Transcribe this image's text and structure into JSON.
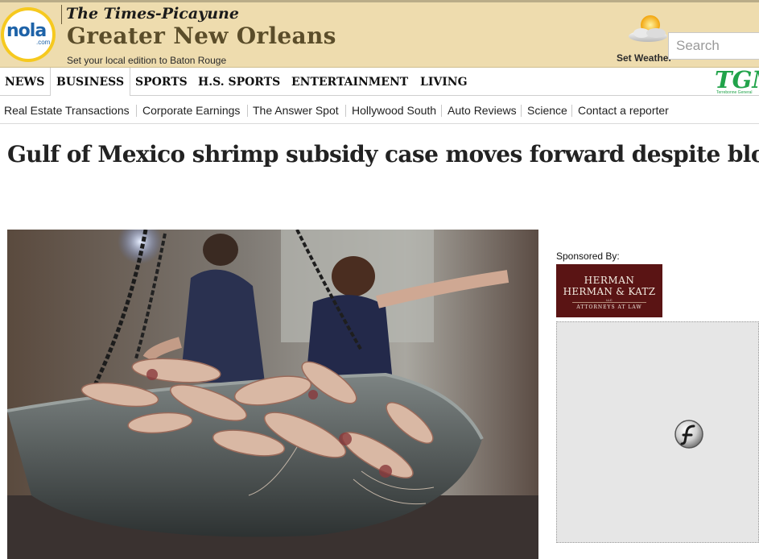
{
  "header": {
    "logo_text": "nola",
    "logo_suffix": ".com",
    "paper_name": "The Times-Picayune",
    "edition_title": "Greater New Orleans",
    "edition_link": "Set your local edition to Baton Rouge",
    "weather_label": "Set Weather",
    "search_placeholder": "Search"
  },
  "main_nav": {
    "items": [
      "NEWS",
      "BUSINESS",
      "SPORTS",
      "H.S. SPORTS",
      "ENTERTAINMENT",
      "LIVING"
    ],
    "active": "BUSINESS",
    "promo": "TGM",
    "promo_sub": "Terrebonne General"
  },
  "sub_nav": {
    "items": [
      "Real Estate Transactions",
      "Corporate Earnings",
      "The Answer Spot",
      "Hollywood South",
      "Auto Reviews",
      "Science",
      "Contact a reporter"
    ]
  },
  "article": {
    "headline": "Gulf of Mexico shrimp subsidy case moves forward despite blow"
  },
  "sidebar": {
    "sponsor_label": "Sponsored By:",
    "sponsor_name_line1": "HERMAN",
    "sponsor_name_line2": "HERMAN & KATZ",
    "sponsor_llc": "LLC",
    "sponsor_tagline": "ATTORNEYS AT LAW"
  },
  "icons": {
    "weather": "partly-cloudy-icon",
    "flash": "flash-plugin-icon"
  },
  "colors": {
    "header_bg": "#eedcae",
    "sponsor_bg": "#5a1414",
    "promo_green": "#21a34a",
    "logo_blue": "#1e63a8",
    "logo_yellow": "#f6c91f"
  }
}
